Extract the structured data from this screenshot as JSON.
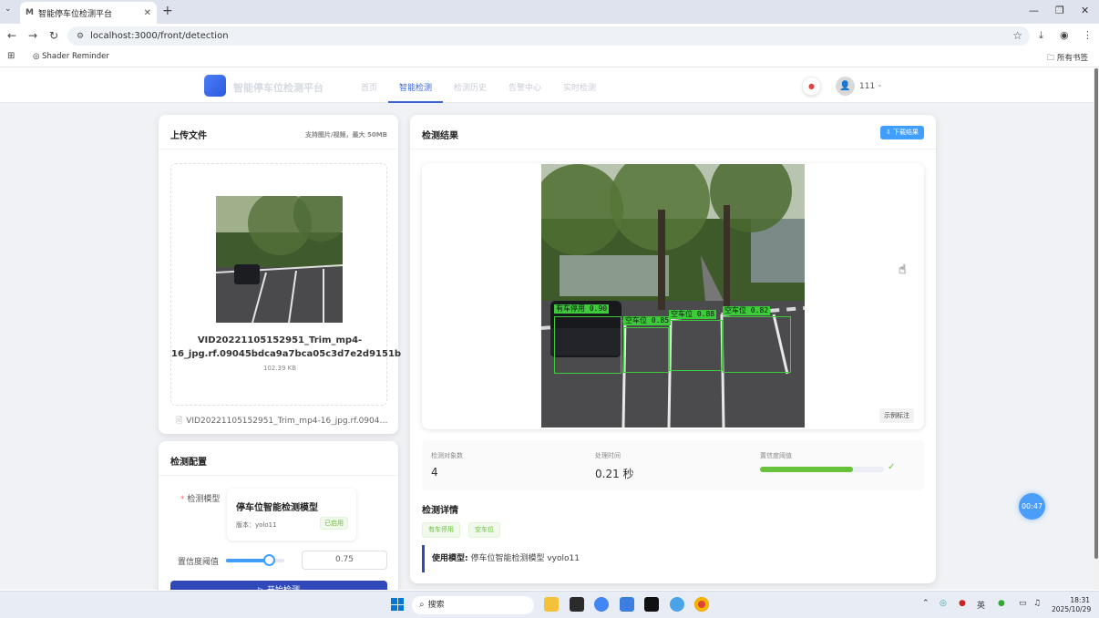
{
  "browser": {
    "tab_title": "智能停车位检测平台",
    "tab_favicon": "M",
    "url": "localhost:3000/front/detection",
    "bookmark": "Shader Reminder",
    "all_bookmarks": "所有书签"
  },
  "app": {
    "brand": "智能停车位检测平台",
    "nav": [
      "首页",
      "智能检测",
      "检测历史",
      "告警中心",
      "实时检测"
    ],
    "active_nav": "智能检测",
    "username": "111"
  },
  "upload": {
    "title": "上传文件",
    "hint": "支持图片/视频，最大 50MB",
    "file_name_display": "VID20221105152951_Trim_mp4-16_jpg.rf.09045bdca9a7bca05c3d7e2d9151b",
    "file_size": "102.39 KB",
    "file_list_name": "VID20221105152951_Trim_mp4-16_jpg.rf.0904…"
  },
  "config": {
    "title": "检测配置",
    "model_label": "检测模型",
    "model_name": "停车位智能检测模型",
    "model_version": "版本：yolo11",
    "model_status": "已启用",
    "threshold_label": "置信度阈值",
    "threshold_value": "0.75",
    "threshold_fraction": 0.75,
    "start_button": "▷ 开始检测"
  },
  "result": {
    "title": "检测结果",
    "download_button": "⇩ 下载结果",
    "view_button": "示例标注",
    "detections": [
      {
        "label": "有车停用 0.90"
      },
      {
        "label": "空车位 0.85"
      },
      {
        "label": "空车位 0.88"
      },
      {
        "label": "空车位 0.82"
      }
    ],
    "stats": {
      "count_label": "检测对象数",
      "count_value": "4",
      "time_label": "处理时间",
      "time_value": "0.21 秒",
      "threshold_label": "置信度阈值",
      "threshold_fraction": 0.75
    },
    "details_title": "检测详情",
    "tags": [
      "有车停用",
      "空车位"
    ],
    "model_used_label": "使用模型:",
    "model_used_value": " 停车位智能检测模型 vyolo11"
  },
  "floating_timer": "00:47",
  "taskbar": {
    "search": "搜索",
    "ime": "英",
    "time": "18:31",
    "date": "2025/10/29"
  },
  "colors": {
    "primary": "#409eff",
    "nav_active": "#3a63d8",
    "success": "#67c23a",
    "detection_box": "#3ccc3a",
    "start_button": "#2f4ab8"
  }
}
